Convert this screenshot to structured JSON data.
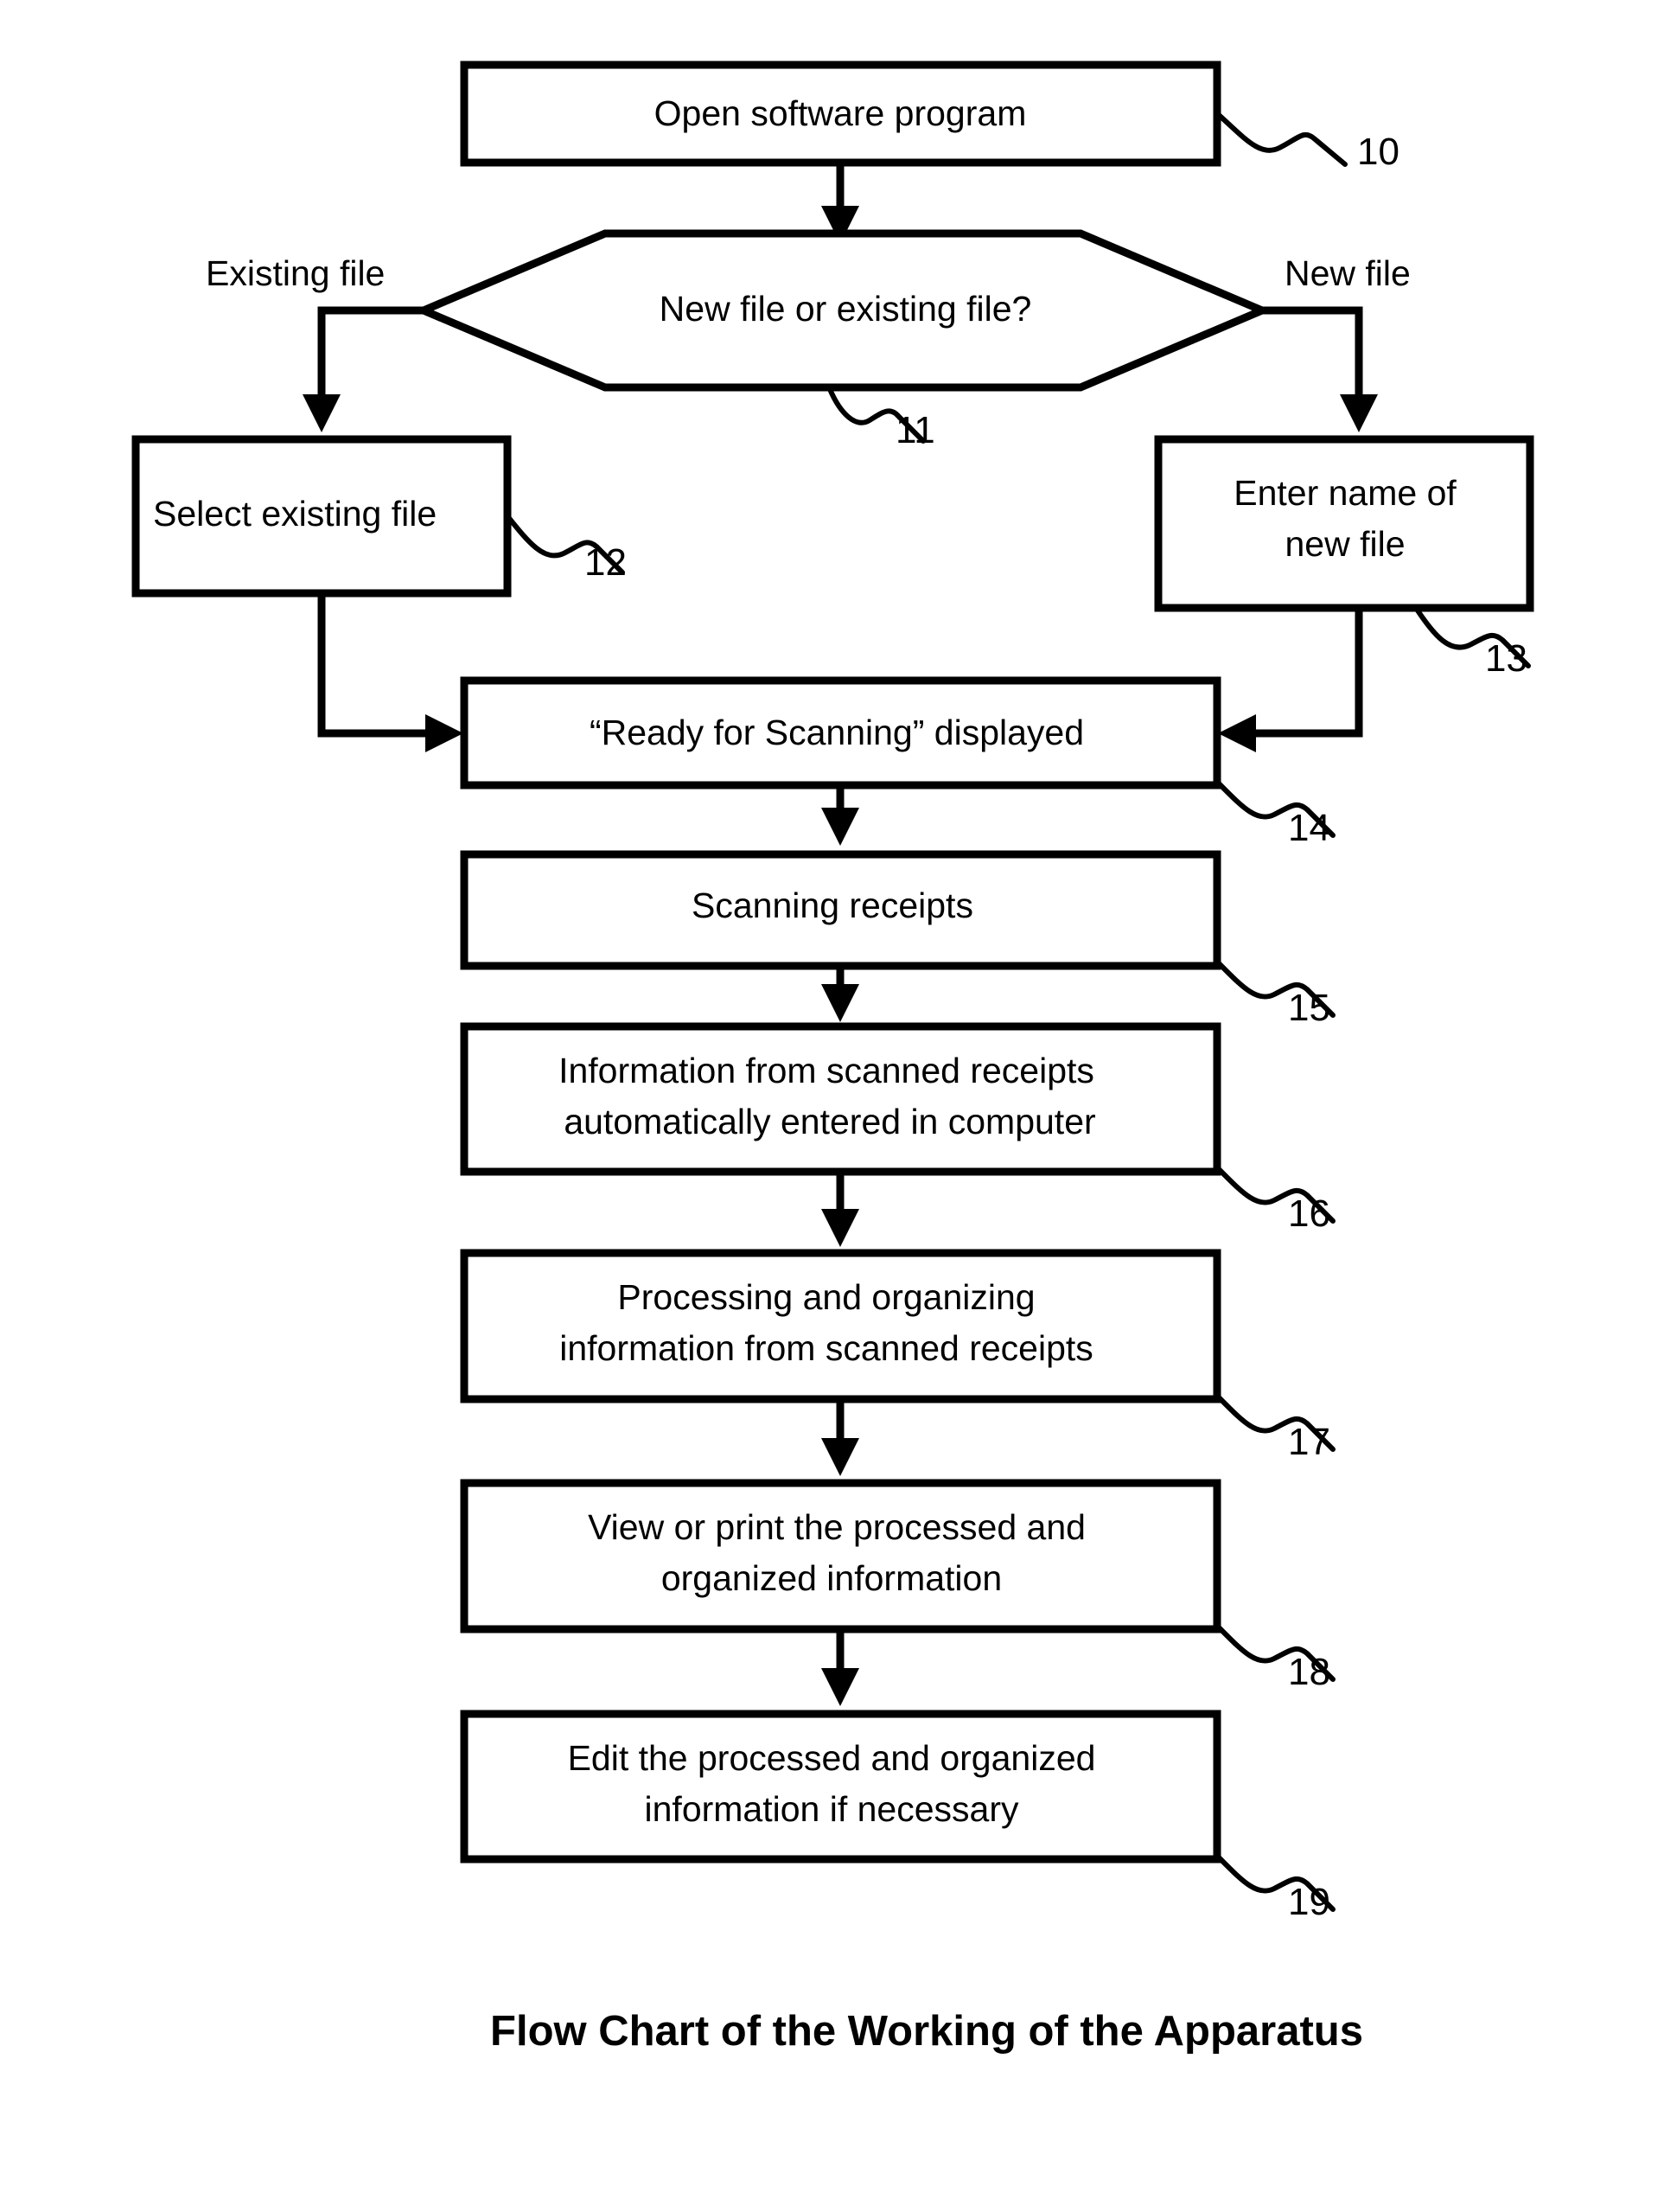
{
  "figure": {
    "caption": "Flow Chart of the Working of the Apparatus",
    "type": "flowchart"
  },
  "chart_data": {
    "type": "diagram",
    "title": "Flow Chart of the Working of the Apparatus",
    "nodes": [
      {
        "id": "n10",
        "ref": "10",
        "shape": "process",
        "lines": [
          "Open software program"
        ]
      },
      {
        "id": "n11",
        "ref": "11",
        "shape": "decision",
        "lines": [
          "New file or existing file?"
        ]
      },
      {
        "id": "n12",
        "ref": "12",
        "shape": "process",
        "lines": [
          "Select existing file"
        ]
      },
      {
        "id": "n13",
        "ref": "13",
        "shape": "process",
        "lines": [
          "Enter name of",
          "new file"
        ]
      },
      {
        "id": "n14",
        "ref": "14",
        "shape": "process",
        "lines": [
          "“Ready for Scanning” displayed"
        ]
      },
      {
        "id": "n15",
        "ref": "15",
        "shape": "process",
        "lines": [
          "Scanning receipts"
        ]
      },
      {
        "id": "n16",
        "ref": "16",
        "shape": "process",
        "lines": [
          "Information from scanned receipts",
          "automatically entered in computer"
        ]
      },
      {
        "id": "n17",
        "ref": "17",
        "shape": "process",
        "lines": [
          "Processing and organizing",
          "information from scanned receipts"
        ]
      },
      {
        "id": "n18",
        "ref": "18",
        "shape": "process",
        "lines": [
          "View or print the processed and",
          "organized information"
        ]
      },
      {
        "id": "n19",
        "ref": "19",
        "shape": "process",
        "lines": [
          "Edit the processed and organized",
          "information if necessary"
        ]
      }
    ],
    "edges": [
      {
        "from": "n10",
        "to": "n11",
        "label": ""
      },
      {
        "from": "n11",
        "to": "n12",
        "label": "Existing file"
      },
      {
        "from": "n11",
        "to": "n13",
        "label": "New file"
      },
      {
        "from": "n12",
        "to": "n14",
        "label": ""
      },
      {
        "from": "n13",
        "to": "n14",
        "label": ""
      },
      {
        "from": "n14",
        "to": "n15",
        "label": ""
      },
      {
        "from": "n15",
        "to": "n16",
        "label": ""
      },
      {
        "from": "n16",
        "to": "n17",
        "label": ""
      },
      {
        "from": "n17",
        "to": "n18",
        "label": ""
      },
      {
        "from": "n18",
        "to": "n19",
        "label": ""
      }
    ],
    "branch_labels": [
      "Existing file",
      "New file"
    ],
    "reference_numerals": [
      "10",
      "11",
      "12",
      "13",
      "14",
      "15",
      "16",
      "17",
      "18",
      "19"
    ]
  },
  "nodes": {
    "n10": {
      "line1": "Open software program",
      "ref": "10"
    },
    "n11": {
      "line1": "New file or existing file?",
      "ref": "11"
    },
    "n12": {
      "line1": "Select existing file",
      "ref": "12"
    },
    "n13": {
      "line1": "Enter name of",
      "line2": "new file",
      "ref": "13"
    },
    "n14": {
      "line1": "“Ready for Scanning” displayed",
      "ref": "14"
    },
    "n15": {
      "line1": "Scanning receipts",
      "ref": "15"
    },
    "n16": {
      "line1": "Information from scanned receipts",
      "line2": "automatically entered in computer",
      "ref": "16"
    },
    "n17": {
      "line1": "Processing and organizing",
      "line2": "information from scanned receipts",
      "ref": "17"
    },
    "n18": {
      "line1": "View or print the processed and",
      "line2": "organized information",
      "ref": "18"
    },
    "n19": {
      "line1": "Edit the processed and organized",
      "line2": "information if necessary",
      "ref": "19"
    }
  },
  "branches": {
    "existing": "Existing file",
    "new": "New file"
  },
  "colors": {
    "stroke": "#000000",
    "fill": "#ffffff",
    "background": "#ffffff"
  }
}
